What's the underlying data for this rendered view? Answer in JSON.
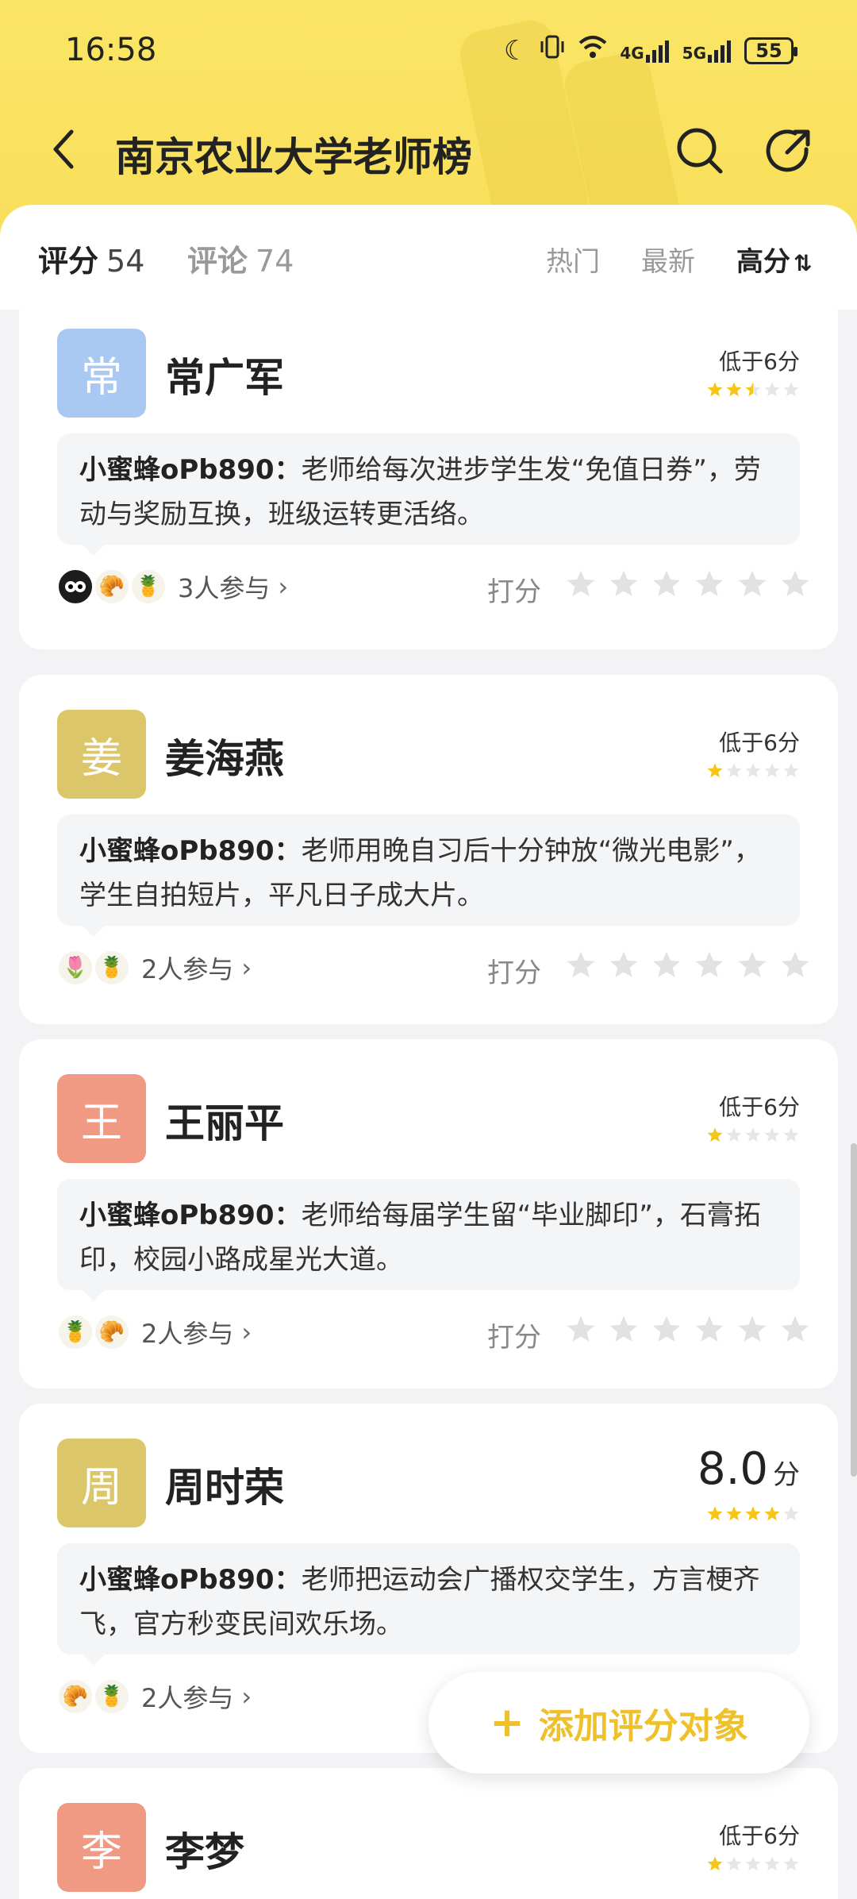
{
  "status": {
    "time": "16:58",
    "battery": "55",
    "net1": "4G",
    "net2": "5G"
  },
  "header": {
    "title": "南京农业大学老师榜"
  },
  "tabs": {
    "rating_label": "评分",
    "rating_count": "54",
    "comment_label": "评论",
    "comment_count": "74"
  },
  "sort": {
    "hot": "热门",
    "new": "最新",
    "high": "高分"
  },
  "rate_label": "打分",
  "colors": {
    "accent": "#eec12a",
    "topbar": "#fbe566",
    "star_on": "#f5c518",
    "star_off": "#e2e2e2"
  },
  "cards": [
    {
      "initial": "常",
      "name": "常广军",
      "avatar_color": "#a9c8f2",
      "score_text": "低于6分",
      "stars": 2.5,
      "comment_user": "小蜜蜂oPb890：",
      "comment_text": "老师给每次进步学生发“免值日券”，劳动与奖励互换，班级运转更活络。",
      "participants": "3人参与",
      "avatar_icons": [
        "face-icon",
        "croissant-icon",
        "fruit-icon"
      ]
    },
    {
      "initial": "姜",
      "name": "姜海燕",
      "avatar_color": "#dcc66a",
      "score_text": "低于6分",
      "stars": 1,
      "comment_user": "小蜜蜂oPb890：",
      "comment_text": "老师用晚自习后十分钟放“微光电影”，学生自拍短片，平凡日子成大片。",
      "participants": "2人参与",
      "avatar_icons": [
        "flower-icon",
        "fruit-icon"
      ]
    },
    {
      "initial": "王",
      "name": "王丽平",
      "avatar_color": "#f09a84",
      "score_text": "低于6分",
      "stars": 1,
      "comment_user": "小蜜蜂oPb890：",
      "comment_text": "老师给每届学生留“毕业脚印”，石膏拓印，校园小路成星光大道。",
      "participants": "2人参与",
      "avatar_icons": [
        "fruit-icon",
        "croissant-icon"
      ]
    },
    {
      "initial": "周",
      "name": "周时荣",
      "avatar_color": "#dcc66a",
      "score_num": "8.0",
      "score_unit": "分",
      "stars": 4,
      "comment_user": "小蜜蜂oPb890：",
      "comment_text": "老师把运动会广播权交学生，方言梗齐飞，官方秒变民间欢乐场。",
      "participants": "2人参与",
      "avatar_icons": [
        "croissant-icon",
        "fruit-icon"
      ]
    },
    {
      "initial": "李",
      "name": "李梦",
      "avatar_color": "#f09a84",
      "score_text": "低于6分",
      "stars": 1
    }
  ],
  "fab": {
    "label": "添加评分对象",
    "plus": "+"
  }
}
